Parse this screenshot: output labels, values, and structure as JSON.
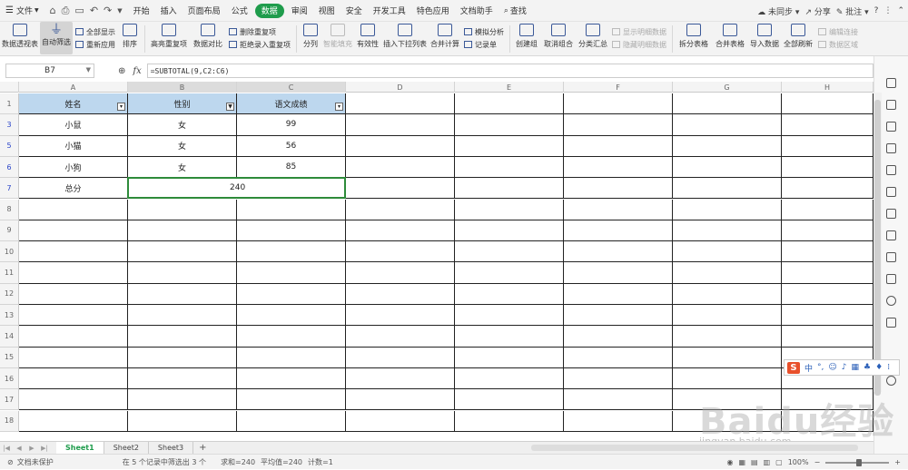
{
  "menubar": {
    "file_label": "文件",
    "tabs": [
      "开始",
      "插入",
      "页面布局",
      "公式",
      "数据",
      "审阅",
      "视图",
      "安全",
      "开发工具",
      "特色应用",
      "文档助手"
    ],
    "active_tab": "数据",
    "search_label": "查找",
    "sync_label": "未同步",
    "share_label": "分享",
    "comment_label": "批注"
  },
  "ribbon": {
    "pivot": "数据透视表",
    "autofilter": "自动筛选",
    "show_all": "全部显示",
    "reapply": "重新应用",
    "sort": "排序",
    "highlight_dup": "高亮重复项",
    "compare": "数据对比",
    "remove_dup": "删除重复项",
    "reject_dup": "拒绝录入重复项",
    "split": "分列",
    "smart_fill": "智能填充",
    "validity": "有效性",
    "dropdown_list": "插入下拉列表",
    "consolidate": "合并计算",
    "simulate": "模拟分析",
    "record_sheet": "记录单",
    "group": "创建组",
    "ungroup": "取消组合",
    "subtotal": "分类汇总",
    "show_detail": "显示明细数据",
    "hide_detail": "隐藏明细数据",
    "split_sheet": "拆分表格",
    "merge_sheet": "合并表格",
    "import_data": "导入数据",
    "refresh_all": "全部刷新",
    "edit_link": "编辑连接",
    "data_area": "数据区域"
  },
  "formula_bar": {
    "cell_ref": "B7",
    "fx": "fx",
    "formula": "=SUBTOTAL(9,C2:C6)"
  },
  "columns": [
    "A",
    "B",
    "C",
    "D",
    "E",
    "F",
    "G",
    "H"
  ],
  "rows": [
    {
      "num": "1",
      "cells": [
        "姓名",
        "性别",
        "语文成绩"
      ]
    },
    {
      "num": "3",
      "cells": [
        "小鼠",
        "女",
        "99"
      ]
    },
    {
      "num": "5",
      "cells": [
        "小猫",
        "女",
        "56"
      ]
    },
    {
      "num": "6",
      "cells": [
        "小狗",
        "女",
        "85"
      ]
    },
    {
      "num": "7",
      "cells": [
        "总分",
        "240",
        ""
      ]
    },
    {
      "num": "8"
    },
    {
      "num": "9"
    },
    {
      "num": "10"
    },
    {
      "num": "11"
    },
    {
      "num": "12"
    },
    {
      "num": "13"
    },
    {
      "num": "14"
    },
    {
      "num": "15"
    },
    {
      "num": "16"
    },
    {
      "num": "17"
    },
    {
      "num": "18"
    }
  ],
  "sheet_tabs": [
    "Sheet1",
    "Sheet2",
    "Sheet3"
  ],
  "active_sheet": "Sheet1",
  "status": {
    "protection": "文档未保护",
    "filter_info": "在 5 个记录中筛选出 3 个",
    "sum": "求和=240",
    "avg": "平均值=240",
    "count": "计数=1",
    "zoom": "100%"
  },
  "ime": {
    "logo": "S",
    "lang": "中"
  },
  "watermark": {
    "main": "Baidu经验",
    "sub": "jingyan.baidu.com"
  },
  "colors": {
    "accent": "#1f9c4c",
    "header_fill": "#bdd7ee",
    "selection": "#2e8b3a"
  }
}
